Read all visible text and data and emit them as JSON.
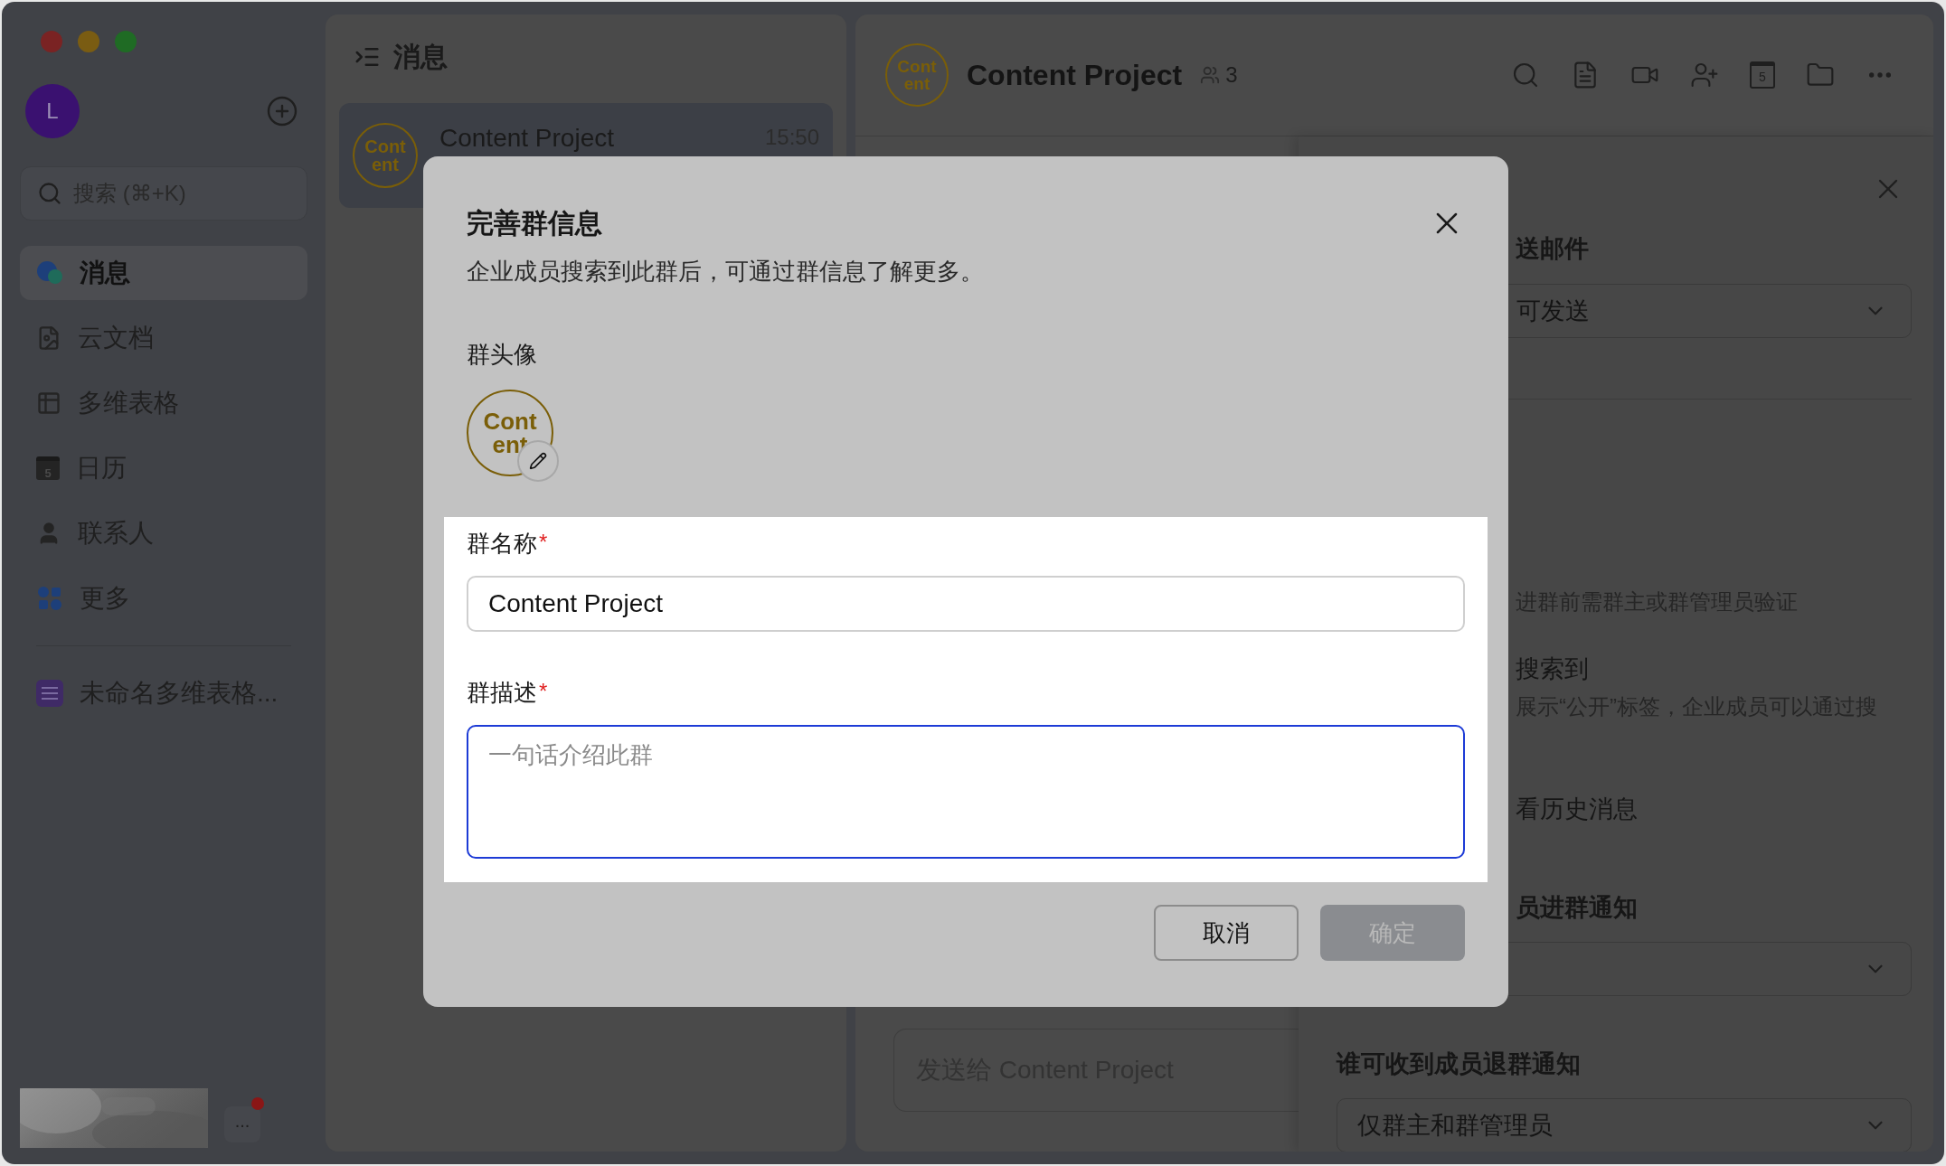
{
  "window_controls": [
    {
      "color": "#7a2323"
    },
    {
      "color": "#7a5c12"
    },
    {
      "color": "#1f6b24"
    }
  ],
  "sidebar": {
    "avatar": "L",
    "search": {
      "placeholder": "搜索 (⌘+K)"
    },
    "items": [
      {
        "kind": "messages",
        "label": "消息",
        "selected": true
      },
      {
        "kind": "docs",
        "label": "云文档",
        "selected": false
      },
      {
        "kind": "base",
        "label": "多维表格",
        "selected": false
      },
      {
        "kind": "calendar",
        "label": "日历",
        "selected": false,
        "icon_text": "5"
      },
      {
        "kind": "contacts",
        "label": "联系人",
        "selected": false
      },
      {
        "kind": "more",
        "label": "更多",
        "selected": false
      }
    ],
    "pinned": [
      {
        "label": "未命名多维表格...",
        "selected": false
      }
    ],
    "more_button": {
      "label": "...",
      "unread": true
    }
  },
  "chat_list": {
    "title": "消息",
    "items": [
      {
        "avatar_lines": [
          "Cont",
          "ent"
        ],
        "name": "Content Project",
        "time": "15:50",
        "selected": true
      }
    ]
  },
  "chat": {
    "avatar_lines": [
      "Cont",
      "ent"
    ],
    "title": "Content Project",
    "member_count": "3",
    "calendar_icon_text": "5",
    "composer": {
      "placeholder": "发送给 Content Project"
    }
  },
  "settings_panel": {
    "rows": [
      {
        "kind": "heading",
        "text": "送邮件",
        "covered": true
      },
      {
        "kind": "select",
        "value": "可发送",
        "covered": true
      },
      {
        "kind": "divider"
      },
      {
        "kind": "hint",
        "text": "进群前需群主或群管理员验证",
        "covered": true
      },
      {
        "kind": "label",
        "text": "搜索到",
        "covered": true
      },
      {
        "kind": "hint",
        "text": "展示“公开”标签，企业成员可以通过搜",
        "covered": true
      },
      {
        "kind": "label",
        "text": "看历史消息",
        "covered": true
      },
      {
        "kind": "heading",
        "text": "员进群通知",
        "covered": true
      },
      {
        "kind": "select"
      },
      {
        "kind": "heading",
        "text": "谁可收到成员退群通知"
      },
      {
        "kind": "select",
        "value": "仅群主和群管理员"
      }
    ]
  },
  "dialog": {
    "title": "完善群信息",
    "description": "企业成员搜索到此群后，可通过群信息了解更多。",
    "avatar_label": "群头像",
    "avatar_lines": [
      "Cont",
      "ent"
    ],
    "fields": [
      {
        "kind": "input",
        "label": "群名称",
        "required_mark": "*",
        "value": "Content Project",
        "focused": false
      },
      {
        "kind": "textarea",
        "label": "群描述",
        "required_mark": "*",
        "placeholder": "一句话介绍此群",
        "focused": true
      }
    ],
    "buttons": [
      {
        "label": "取消",
        "primary": false,
        "disabled": false
      },
      {
        "label": "确定",
        "primary": true,
        "disabled": true
      }
    ]
  }
}
